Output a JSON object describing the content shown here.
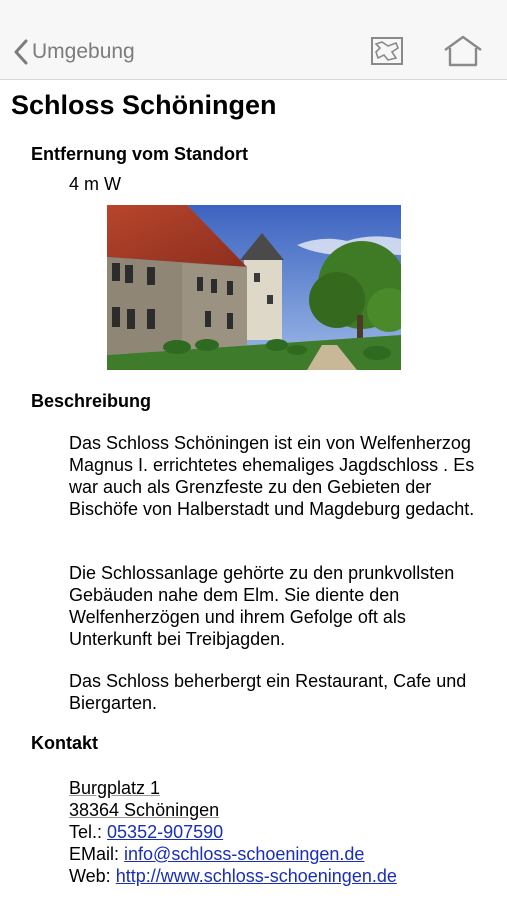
{
  "navbar": {
    "back_label": "Umgebung",
    "map_icon": "map-icon",
    "home_icon": "home-icon"
  },
  "page": {
    "title": "Schloss Schöningen"
  },
  "distance": {
    "heading": "Entfernung vom Standort",
    "value": "4 m W"
  },
  "photo": {
    "subject": "castle-photo"
  },
  "description": {
    "heading": "Beschreibung",
    "paragraphs": [
      "Das Schloss Schöningen ist ein von Welfenherzog Magnus I. errichtetes ehemaliges Jagdschloss . Es war auch als Grenzfeste zu den Gebieten der Bischöfe von Halberstadt und Magdeburg gedacht.",
      "Die Schlossanlage gehörte zu den prunkvollsten Gebäuden nahe dem Elm. Sie diente den Welfenherzögen und ihrem Gefolge oft als Unterkunft bei Treibjagden.",
      "Das Schloss beherbergt ein Restaurant, Cafe und Biergarten."
    ]
  },
  "contact": {
    "heading": "Kontakt",
    "street": "Burgplatz 1",
    "city": "38364 Schöningen",
    "phone_label": "Tel.:",
    "phone": "05352-907590",
    "email_label": "EMail:",
    "email": "info@schloss-schoeningen.de",
    "web_label": "Web:",
    "web": "http://www.schloss-schoeningen.de"
  },
  "colors": {
    "link": "#1a2fb5",
    "navbar_bg": "#f7f7f7",
    "nav_tint": "#7c7c7c"
  }
}
